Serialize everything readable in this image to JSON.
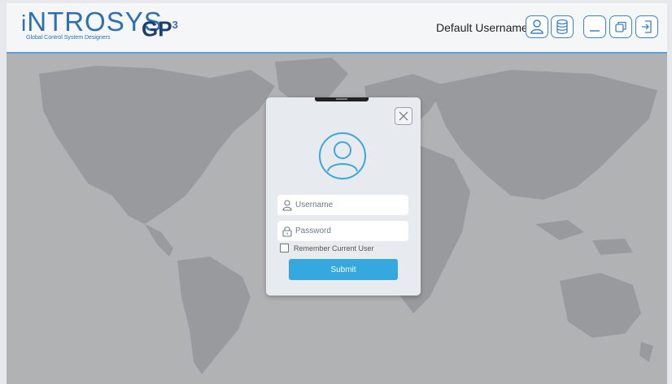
{
  "header": {
    "logo_text": "NTROSYS",
    "logo_tagline": "Global Control System Designers",
    "product": "GP",
    "product_sup": "3",
    "username": "Default Username",
    "buttons": [
      {
        "icon": "user-icon"
      },
      {
        "icon": "database-icon"
      },
      {
        "icon": "minimize-icon"
      },
      {
        "icon": "restore-window-icon"
      },
      {
        "icon": "logout-icon"
      }
    ]
  },
  "login": {
    "username_placeholder": "Username",
    "password_placeholder": "Password",
    "remember_label": "Remember Current User",
    "submit_label": "Submit"
  },
  "colors": {
    "accent": "#35a8e0",
    "header_border": "#5a9fd6",
    "brand": "#2f6fad"
  }
}
